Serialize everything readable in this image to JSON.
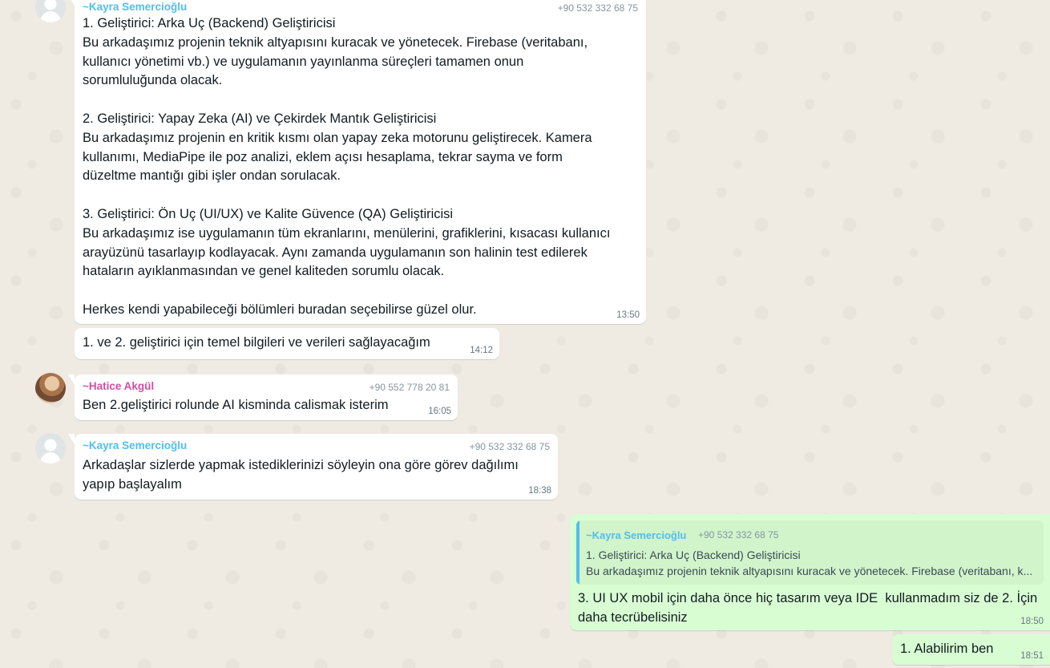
{
  "messages": {
    "m1": {
      "sender": "~Kayra Semercioğlu",
      "phone": "+90 532 332 68 75",
      "text": "1. Geliştirici: Arka Uç (Backend) Geliştiricisi\nBu arkadaşımız projenin teknik altyapısını kuracak ve yönetecek. Firebase (veritabanı,\nkullanıcı yönetimi vb.) ve uygulamanın yayınlanma süreçleri tamamen onun\nsorumluluğunda olacak.\n\n2. Geliştirici: Yapay Zeka (AI) ve Çekirdek Mantık Geliştiricisi\nBu arkadaşımız projenin en kritik kısmı olan yapay zeka motorunu geliştirecek. Kamera\nkullanımı, MediaPipe ile poz analizi, eklem açısı hesaplama, tekrar sayma ve form\ndüzeltme mantığı gibi işler ondan sorulacak.\n\n3. Geliştirici: Ön Uç (UI/UX) ve Kalite Güvence (QA) Geliştiricisi\nBu arkadaşımız ise uygulamanın tüm ekranlarını, menülerini, grafiklerini, kısacası kullanıcı\narayüzünü tasarlayıp kodlayacak. Aynı zamanda uygulamanın son halinin test edilerek\nhataların ayıklanmasından ve genel kaliteden sorumlu olacak.\n\nHerkes kendi yapabileceği bölümleri buradan seçebilirse güzel olur.",
      "time": "13:50"
    },
    "m2": {
      "text": "1. ve 2. geliştirici için temel bilgileri ve verileri sağlayacağım",
      "time": "14:12"
    },
    "m3": {
      "sender": "~Hatice Akgül",
      "phone": "+90 552 778 20 81",
      "text": "Ben 2.geliştirici rolunde AI kisminda calismak isterim",
      "time": "16:05"
    },
    "m4": {
      "sender": "~Kayra Semercioğlu",
      "phone": "+90 532 332 68 75",
      "text": "Arkadaşlar sizlerde yapmak istediklerinizi söyleyin ona göre görev dağılımı\nyapıp başlayalım",
      "time": "18:38"
    },
    "m5": {
      "quote": {
        "sender": "~Kayra Semercioğlu",
        "phone": "+90 532 332 68 75",
        "line1": "1. Geliştirici: Arka Uç (Backend) Geliştiricisi",
        "line2": "Bu arkadaşımız projenin teknik altyapısını kuracak ve yönetecek. Firebase (veritabanı, k..."
      },
      "text": "3. UI UX mobil için daha önce hiç tasarım veya IDE  kullanmadım siz de 2. İçin\ndaha tecrübelisiniz",
      "time": "18:50"
    },
    "m6": {
      "text": "1. Alabilirim ben",
      "time": "18:51"
    }
  },
  "icons": {
    "default_avatar": "person-silhouette-icon",
    "photo_avatar": "profile-photo"
  },
  "colors": {
    "background": "#efeae2",
    "incoming_bubble": "#ffffff",
    "outgoing_bubble": "#d9fdd3",
    "sender_blue": "#53bdeb",
    "sender_pink": "#d04fa3"
  }
}
